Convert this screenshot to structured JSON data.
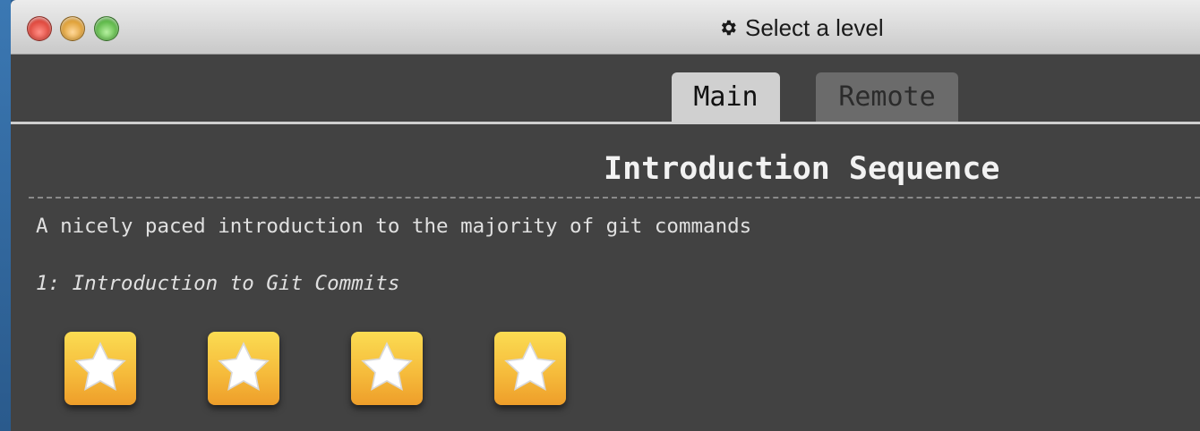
{
  "window": {
    "title": "Select a level",
    "title_icon": "gear-icon"
  },
  "tabs": [
    {
      "label": "Main",
      "active": true
    },
    {
      "label": "Remote",
      "active": false
    }
  ],
  "sequence": {
    "title": "Introduction Sequence",
    "description": "A nicely paced introduction to the majority of git commands",
    "current_level": "1: Introduction to Git Commits",
    "levels": [
      {
        "icon": "star-icon",
        "completed": true
      },
      {
        "icon": "star-icon",
        "completed": true
      },
      {
        "icon": "star-icon",
        "completed": true
      },
      {
        "icon": "star-icon",
        "completed": true
      }
    ]
  },
  "colors": {
    "window_bg": "#424242",
    "level_icon_gold": "#f5b93a",
    "active_tab": "#d0d0d0",
    "inactive_tab": "#6b6b6b"
  }
}
